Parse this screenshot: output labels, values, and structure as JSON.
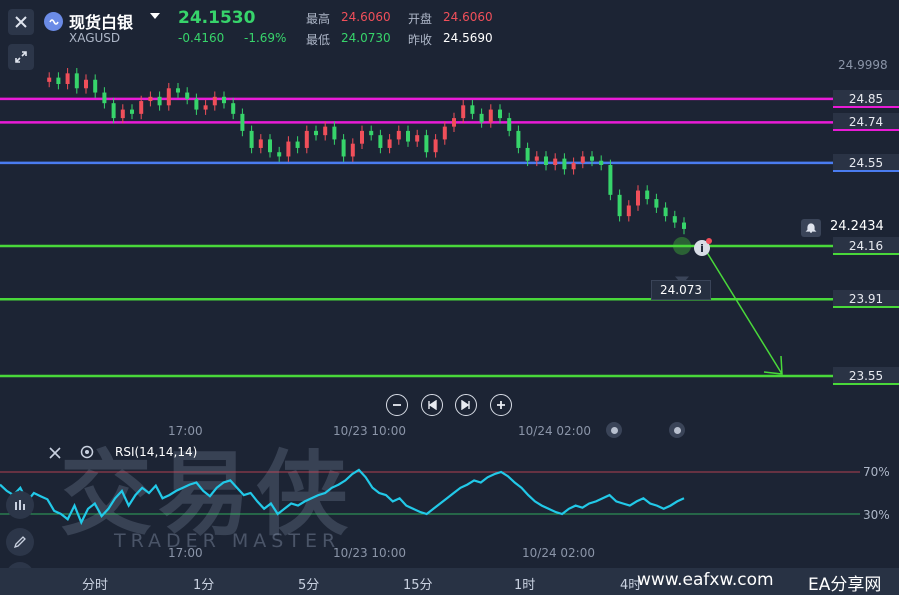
{
  "header": {
    "name": "现货白银",
    "code": "XAGUSD",
    "last": "24.1530",
    "change": "-0.4160",
    "change_pct": "-1.69%",
    "high_label": "最高",
    "high": "24.6060",
    "open_label": "开盘",
    "open": "24.6060",
    "low_label": "最低",
    "low": "24.0730",
    "prev_label": "昨收",
    "prev": "24.5690"
  },
  "axis": {
    "top_value": "24.9998",
    "current_price": "24.2434",
    "low_marker": "24.073"
  },
  "levels": [
    {
      "label": "24.85",
      "price": 24.85,
      "color": "#e81bd6"
    },
    {
      "label": "24.74",
      "price": 24.74,
      "color": "#e81bd6"
    },
    {
      "label": "24.55",
      "price": 24.55,
      "color": "#4a7cf0"
    },
    {
      "label": "24.16",
      "price": 24.16,
      "color": "#49d83a"
    },
    {
      "label": "23.91",
      "price": 23.91,
      "color": "#49d83a"
    },
    {
      "label": "23.55",
      "price": 23.55,
      "color": "#49d83a"
    }
  ],
  "time_labels": [
    "17:00",
    "10/23 10:00",
    "10/24 02:00"
  ],
  "rsi": {
    "label": "RSI(14,14,14)",
    "upper": "70%",
    "lower": "30%",
    "values": [
      58,
      52,
      48,
      55,
      42,
      50,
      47,
      44,
      33,
      30,
      25,
      38,
      22,
      35,
      40,
      28,
      35,
      45,
      52,
      38,
      48,
      55,
      50,
      57,
      45,
      48,
      52,
      55,
      58,
      60,
      52,
      47,
      55,
      60,
      62,
      55,
      48,
      50,
      42,
      35,
      40,
      30,
      35,
      40,
      38,
      42,
      45,
      48,
      50,
      55,
      58,
      62,
      68,
      72,
      65,
      55,
      50,
      48,
      42,
      45,
      38,
      35,
      32,
      30,
      35,
      40,
      45,
      50,
      55,
      58,
      62,
      60,
      65,
      68,
      70,
      66,
      60,
      55,
      48,
      42,
      38,
      35,
      32,
      30,
      35,
      38,
      36,
      40,
      42,
      45,
      48,
      42,
      40,
      38,
      42,
      45,
      40,
      38,
      35,
      38,
      42,
      45
    ]
  },
  "periods": [
    "分时",
    "1分",
    "5分",
    "15分",
    "1时",
    "4时"
  ],
  "watermark": {
    "cn": "交易侠",
    "en": "TRADER MASTER"
  },
  "footer": {
    "url": "www.eafxw.com",
    "site": "EA分享网"
  },
  "colors": {
    "up": "#f04f5a",
    "down": "#37d46b",
    "rsi_line": "#22c9e8"
  }
}
